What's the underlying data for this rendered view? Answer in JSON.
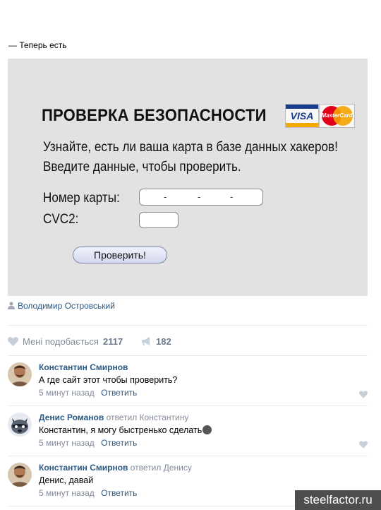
{
  "post": {
    "intro_text": "— Теперь есть"
  },
  "banner": {
    "title": "ПРОВЕРКА БЕЗОПАСНОСТИ",
    "card_logos": {
      "visa": "VISA",
      "mastercard": "MasterCard"
    },
    "line1": "Узнайте, есть ли ваша карта в базе данных хакеров!",
    "line2": "Введите данные, чтобы проверить.",
    "card_number_label": "Номер карты:",
    "card_number_value": "-   -   -",
    "cvc_label": "CVC2:",
    "cvc_value": "",
    "check_button": "Проверить!"
  },
  "author": {
    "name": "Володимир Островський",
    "icon": "person-icon"
  },
  "stats": {
    "like_label": "Мені подобається",
    "like_count": "2117",
    "share_count": "182",
    "like_icon": "heart-icon",
    "share_icon": "megaphone-icon"
  },
  "comments": [
    {
      "author": "Константин Смирнов",
      "reply_to": "",
      "text": "А где сайт этот чтобы проверить?",
      "time": "5 минут назад",
      "reply_label": "Ответить",
      "avatar": "man-avatar"
    },
    {
      "author": "Денис Романов",
      "reply_to": "ответил Константину",
      "text": "Константин, я могу быстренько сделать",
      "time": "5 минут назад",
      "reply_label": "Ответить",
      "avatar": "raccoon-avatar"
    },
    {
      "author": "Константин Смирнов",
      "reply_to": "ответил Денису",
      "text": "Денис, давай",
      "time": "5 минут назад",
      "reply_label": "Ответить",
      "avatar": "man-avatar"
    }
  ],
  "watermark": "steelfactor.ru",
  "colors": {
    "link": "#2a5885",
    "muted": "#828a99",
    "banner_bg": "#e2e2e2"
  }
}
